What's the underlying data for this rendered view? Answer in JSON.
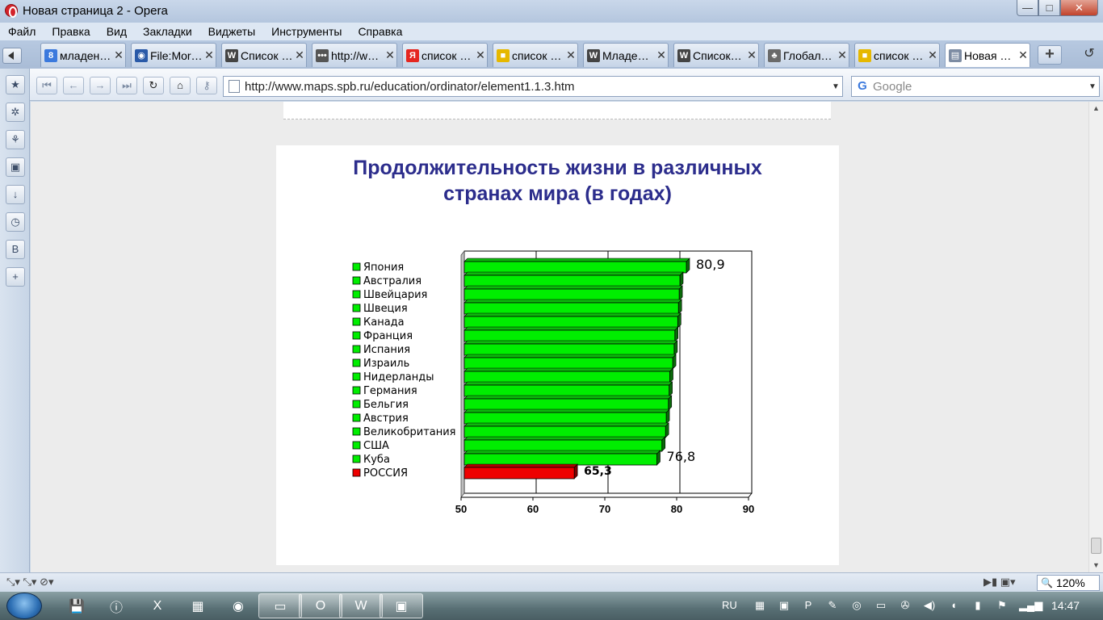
{
  "window": {
    "title": "Новая страница 2 - Opera",
    "minimize_glyph": "—",
    "maximize_glyph": "□",
    "close_glyph": "✕"
  },
  "menu": [
    "Файл",
    "Правка",
    "Вид",
    "Закладки",
    "Виджеты",
    "Инструменты",
    "Справка"
  ],
  "tabs": [
    {
      "label": "младен…",
      "icon": "g-favicon",
      "icon_glyph": "8",
      "icon_color": "#3b79dd"
    },
    {
      "label": "File:Mor…",
      "icon": "globe-favicon",
      "icon_glyph": "◉",
      "icon_color": "#2a5aa8"
    },
    {
      "label": "Список …",
      "icon": "wikipedia-favicon",
      "icon_glyph": "W",
      "icon_color": "#444444"
    },
    {
      "label": "http://w…",
      "icon": "dots-favicon",
      "icon_glyph": "•••",
      "icon_color": "#555555"
    },
    {
      "label": "список …",
      "icon": "yandex-favicon",
      "icon_glyph": "Я",
      "icon_color": "#e52620"
    },
    {
      "label": "список …",
      "icon": "yellow-doc-favicon",
      "icon_glyph": "■",
      "icon_color": "#e6b800"
    },
    {
      "label": "Младе…",
      "icon": "wikipedia-favicon",
      "icon_glyph": "W",
      "icon_color": "#444444"
    },
    {
      "label": "Список…",
      "icon": "wikipedia-favicon",
      "icon_glyph": "W",
      "icon_color": "#444444"
    },
    {
      "label": "Глобал…",
      "icon": "tree-favicon",
      "icon_glyph": "♣",
      "icon_color": "#6a6a6a"
    },
    {
      "label": "список …",
      "icon": "yellow-doc-favicon",
      "icon_glyph": "■",
      "icon_color": "#e6b800"
    },
    {
      "label": "Новая …",
      "icon": "page-favicon",
      "icon_glyph": "▤",
      "icon_color": "#7d8ca3",
      "active": true
    }
  ],
  "tab_close_glyph": "✕",
  "new_tab_glyph": "+",
  "closed_tabs_glyph": "↺",
  "navigation": {
    "first_glyph": "⏮",
    "back_glyph": "←",
    "forward_glyph": "→",
    "last_glyph": "⏭",
    "reload_glyph": "↻",
    "home_glyph": "⌂",
    "wand_glyph": "⚷"
  },
  "address": {
    "url": "http://www.maps.spb.ru/education/ordinator/element1.1.3.htm",
    "dropdown_glyph": "▼"
  },
  "search": {
    "engine_glyph": "G",
    "placeholder": "Google",
    "dropdown_glyph": "▼"
  },
  "side_panel": [
    {
      "name": "bookmarks-icon",
      "glyph": "★"
    },
    {
      "name": "widgets-icon",
      "glyph": "✲"
    },
    {
      "name": "unite-icon",
      "glyph": "⚘"
    },
    {
      "name": "notes-icon",
      "glyph": "▣"
    },
    {
      "name": "downloads-icon",
      "glyph": "↓"
    },
    {
      "name": "history-icon",
      "glyph": "◷"
    },
    {
      "name": "vk-icon",
      "glyph": "B"
    },
    {
      "name": "add-panel-icon",
      "glyph": "+"
    }
  ],
  "status": {
    "left_icons": "⤡▾  ⤡▾  ⊘▾",
    "right_icons": "▶▮  ▣▾",
    "zoom_icon": "🔍",
    "zoom": "120%"
  },
  "scrollbar": {
    "up_glyph": "▲",
    "down_glyph": "▼"
  },
  "taskbar": {
    "language": "RU",
    "clock": "14:47",
    "items": [
      {
        "name": "save-icon",
        "glyph": "💾"
      },
      {
        "name": "info-icon",
        "glyph": "ⓘ"
      },
      {
        "name": "excel-icon",
        "glyph": "X"
      },
      {
        "name": "paint-icon",
        "glyph": "▦"
      },
      {
        "name": "firefox-icon",
        "glyph": "◉"
      },
      {
        "name": "explorer-icon",
        "glyph": "▭"
      },
      {
        "name": "opera-icon",
        "glyph": "O"
      },
      {
        "name": "word-icon",
        "glyph": "W"
      },
      {
        "name": "window-icon",
        "glyph": "▣"
      }
    ],
    "tray": [
      "▦",
      "▣",
      "P",
      "✎",
      "◎",
      "▭",
      "✇",
      "◀)",
      "◖",
      "▮",
      "⚑",
      "▂▄▆"
    ]
  },
  "chart_data": {
    "type": "bar",
    "orientation": "horizontal",
    "title": "Продолжительность жизни в различных странах мира (в годах)",
    "title_lines": [
      "Продолжительность жизни в различных",
      "странах мира (в годах)"
    ],
    "categories": [
      "Япония",
      "Австралия",
      "Швейцария",
      "Швеция",
      "Канада",
      "Франция",
      "Испания",
      "Израиль",
      "Нидерланды",
      "Германия",
      "Бельгия",
      "Австрия",
      "Великобритания",
      "США",
      "Куба",
      "РОССИЯ"
    ],
    "values": [
      80.9,
      80.0,
      79.9,
      79.8,
      79.7,
      79.3,
      79.2,
      79.0,
      78.6,
      78.5,
      78.4,
      78.1,
      78.0,
      77.5,
      76.8,
      65.3
    ],
    "bar_colors": [
      "#00ee00",
      "#00ee00",
      "#00ee00",
      "#00ee00",
      "#00ee00",
      "#00ee00",
      "#00ee00",
      "#00ee00",
      "#00ee00",
      "#00ee00",
      "#00ee00",
      "#00ee00",
      "#00ee00",
      "#00ee00",
      "#00ee00",
      "#ee0000"
    ],
    "data_labels": [
      {
        "index": 0,
        "text": "80,9"
      },
      {
        "index": 14,
        "text": "76,8"
      },
      {
        "index": 15,
        "text": "65,3"
      }
    ],
    "xlim": [
      50,
      90
    ],
    "xticks": [
      "50",
      "60",
      "70",
      "80",
      "90"
    ],
    "grid": true,
    "legend": "left",
    "title_color": "#2c2d8c"
  }
}
